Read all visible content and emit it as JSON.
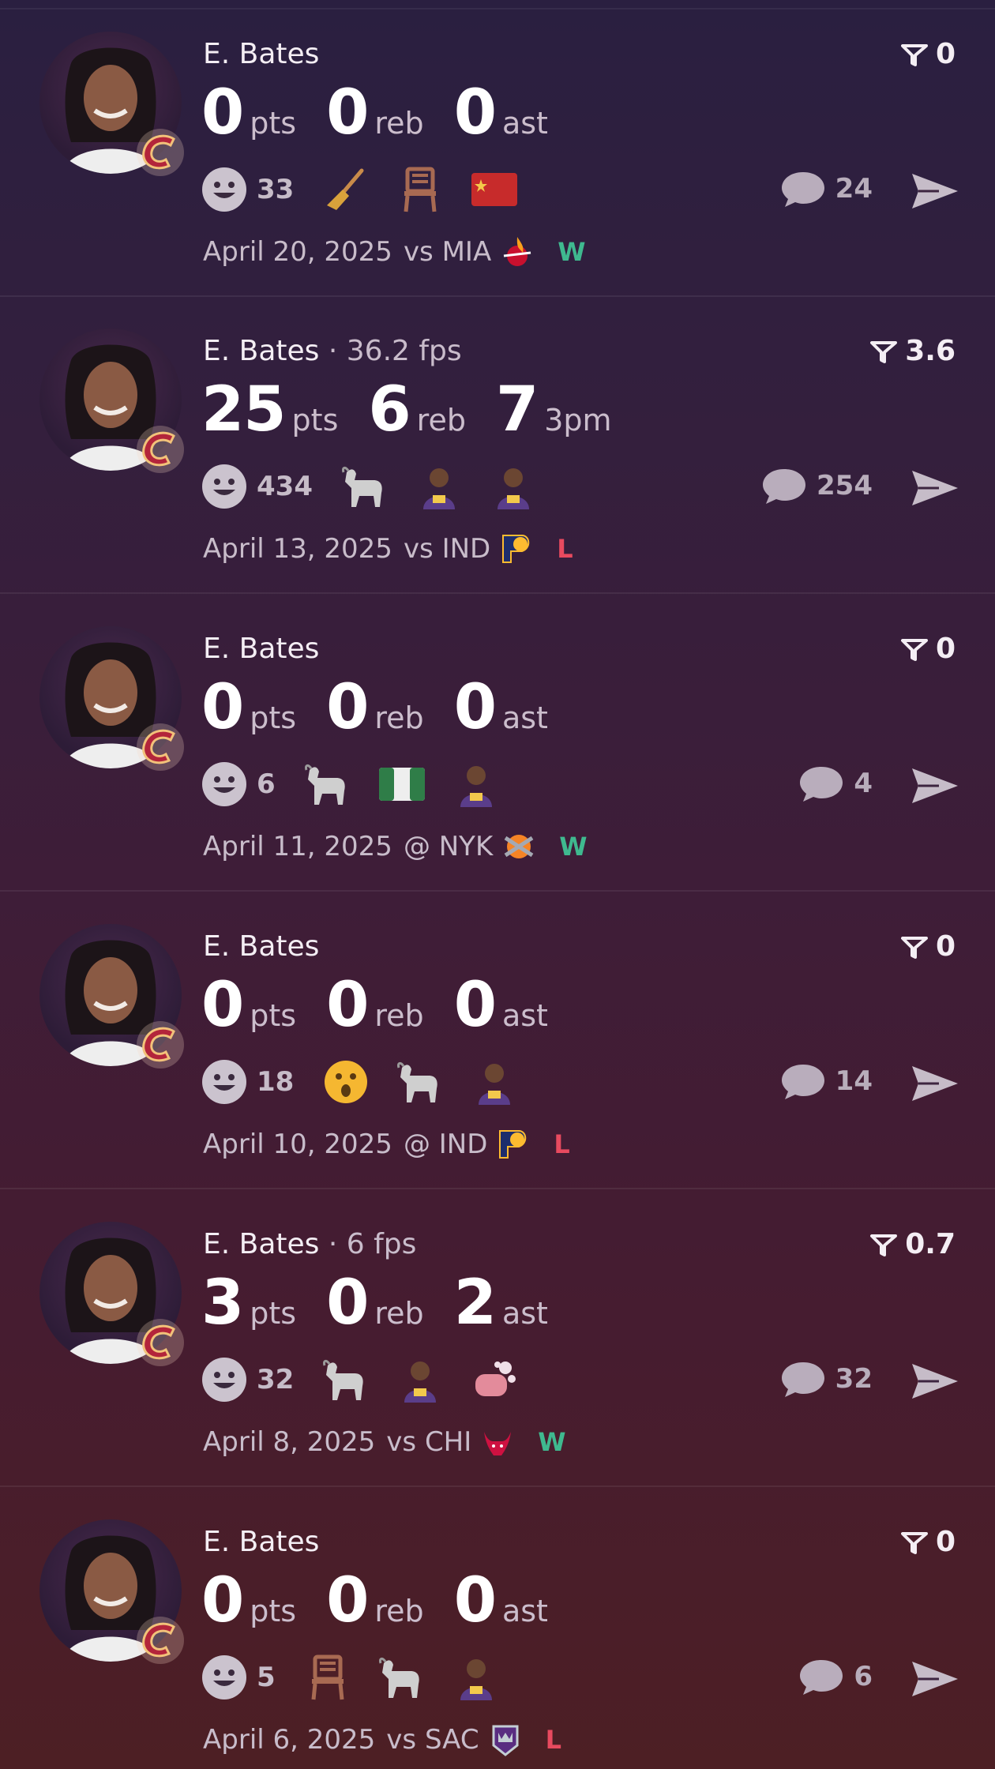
{
  "colors": {
    "win": "#3fb98f",
    "loss": "#e84a5f",
    "muted": "#c6bcc8"
  },
  "posts": [
    {
      "player": "E. Bates",
      "fps": "",
      "score": "0",
      "stats": [
        {
          "num": "0",
          "unit": "pts"
        },
        {
          "num": "0",
          "unit": "reb"
        },
        {
          "num": "0",
          "unit": "ast"
        }
      ],
      "reactions": "33",
      "emojis": [
        "broom-emoji",
        "chair-emoji",
        "china-flag-emoji"
      ],
      "comments": "24",
      "date": "April 20, 2025",
      "matchup": "vs MIA",
      "opponent_logo": "heat-logo",
      "result": "W"
    },
    {
      "player": "E. Bates",
      "fps": "· 36.2 fps",
      "score": "3.6",
      "stats": [
        {
          "num": "25",
          "unit": "pts"
        },
        {
          "num": "6",
          "unit": "reb"
        },
        {
          "num": "7",
          "unit": "3pm"
        }
      ],
      "reactions": "434",
      "emojis": [
        "goat-emoji",
        "player-photo-emoji",
        "player-photo-emoji"
      ],
      "comments": "254",
      "date": "April 13, 2025",
      "matchup": "vs IND",
      "opponent_logo": "pacers-logo",
      "result": "L"
    },
    {
      "player": "E. Bates",
      "fps": "",
      "score": "0",
      "stats": [
        {
          "num": "0",
          "unit": "pts"
        },
        {
          "num": "0",
          "unit": "reb"
        },
        {
          "num": "0",
          "unit": "ast"
        }
      ],
      "reactions": "6",
      "emojis": [
        "goat-emoji",
        "nigeria-flag-emoji",
        "player-photo-emoji"
      ],
      "comments": "4",
      "date": "April 11, 2025",
      "matchup": "@ NYK",
      "opponent_logo": "knicks-logo",
      "result": "W"
    },
    {
      "player": "E. Bates",
      "fps": "",
      "score": "0",
      "stats": [
        {
          "num": "0",
          "unit": "pts"
        },
        {
          "num": "0",
          "unit": "reb"
        },
        {
          "num": "0",
          "unit": "ast"
        }
      ],
      "reactions": "18",
      "emojis": [
        "surprised-face-emoji",
        "goat-emoji",
        "player-photo-emoji"
      ],
      "comments": "14",
      "date": "April 10, 2025",
      "matchup": "@ IND",
      "opponent_logo": "pacers-logo",
      "result": "L"
    },
    {
      "player": "E. Bates",
      "fps": "· 6 fps",
      "score": "0.7",
      "stats": [
        {
          "num": "3",
          "unit": "pts"
        },
        {
          "num": "0",
          "unit": "reb"
        },
        {
          "num": "2",
          "unit": "ast"
        }
      ],
      "reactions": "32",
      "emojis": [
        "goat-emoji",
        "player-photo-emoji",
        "soap-emoji"
      ],
      "comments": "32",
      "date": "April 8, 2025",
      "matchup": "vs CHI",
      "opponent_logo": "bulls-logo",
      "result": "W"
    },
    {
      "player": "E. Bates",
      "fps": "",
      "score": "0",
      "stats": [
        {
          "num": "0",
          "unit": "pts"
        },
        {
          "num": "0",
          "unit": "reb"
        },
        {
          "num": "0",
          "unit": "ast"
        }
      ],
      "reactions": "5",
      "emojis": [
        "chair-emoji",
        "goat-emoji",
        "player-photo-emoji"
      ],
      "comments": "6",
      "date": "April 6, 2025",
      "matchup": "vs SAC",
      "opponent_logo": "kings-logo",
      "result": "L"
    }
  ]
}
